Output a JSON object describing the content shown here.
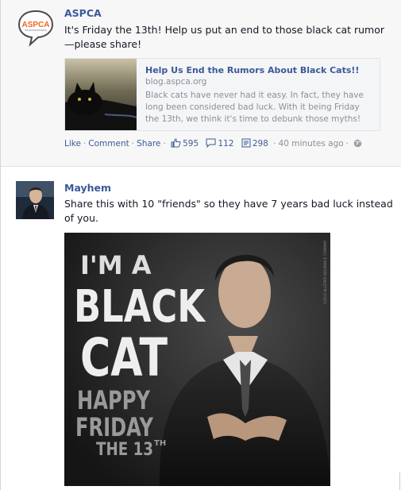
{
  "post1": {
    "author": "ASPCA",
    "avatar_text": "ASPCA",
    "message": "It's Friday the 13th! Help us put an end to those black cat rumor—please share!",
    "link": {
      "title": "Help Us End the Rumors About Black Cats!!",
      "domain": "blog.aspca.org",
      "description": "Black cats have never had it easy. In fact, they have long been considered bad luck. With it being Friday the 13th, we think it's time to debunk those myths!",
      "thumbnail_icon": "black-cat-photo"
    },
    "actions": {
      "like": "Like",
      "comment": "Comment",
      "share": "Share",
      "sep": "·",
      "likes_count": "595",
      "comments_count": "112",
      "shares_count": "298",
      "time": "40 minutes ago",
      "privacy_icon": "globe-icon"
    }
  },
  "post2": {
    "author": "Mayhem",
    "message": "Share this with 10 \"friends\" so they have 7 years bad luck instead of you.",
    "image": {
      "line1": "I'M A",
      "line2": "BLACK",
      "line3": "CAT",
      "line4": "HAPPY",
      "line5": "FRIDAY",
      "line6": "THE 13",
      "line6_sup": "TH",
      "credit": "©2013 ALLSTATE INSURANCE COMPANY"
    }
  },
  "colors": {
    "link_blue": "#3b5998",
    "muted_gray": "#8a8f99",
    "post_bg": "#f7f7f7"
  }
}
